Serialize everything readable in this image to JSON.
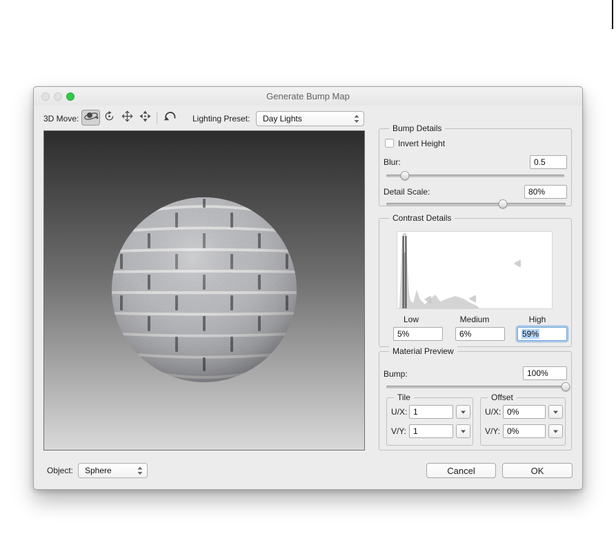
{
  "window": {
    "title": "Generate Bump Map"
  },
  "toolbar": {
    "move_label": "3D Move:",
    "tools": [
      "orbit",
      "roll",
      "pan",
      "slide"
    ],
    "selected_tool": "orbit",
    "lighting_preset_label": "Lighting Preset:",
    "lighting_preset_value": "Day Lights"
  },
  "bump_details": {
    "legend": "Bump Details",
    "invert_height_label": "Invert Height",
    "invert_height_checked": false,
    "blur_label": "Blur:",
    "blur_value": "0.5",
    "blur_slider_pct": 10.5,
    "detail_scale_label": "Detail Scale:",
    "detail_scale_value": "80%",
    "detail_scale_slider_pct": 65
  },
  "contrast_details": {
    "legend": "Contrast Details",
    "columns": [
      {
        "label": "Low",
        "value": "5%"
      },
      {
        "label": "Medium",
        "value": "6%"
      },
      {
        "label": "High",
        "value": "59%"
      }
    ],
    "high_focused": true,
    "histogram": {
      "markers": {
        "low": {
          "left_pct": 19.5,
          "top_pct": 88
        },
        "medium": {
          "left_pct": 48.7,
          "top_pct": 87
        },
        "high": {
          "left_pct": 77.5,
          "top_pct": 41
        }
      }
    }
  },
  "material_preview": {
    "legend": "Material Preview",
    "bump_label": "Bump:",
    "bump_value": "100%",
    "bump_slider_pct": 99.3,
    "tile": {
      "legend": "Tile",
      "rows": [
        {
          "label": "U/X:",
          "value": "1"
        },
        {
          "label": "V/Y:",
          "value": "1"
        }
      ]
    },
    "offset": {
      "legend": "Offset",
      "rows": [
        {
          "label": "U/X:",
          "value": "0%"
        },
        {
          "label": "V/Y:",
          "value": "0%"
        }
      ]
    }
  },
  "footer": {
    "object_label": "Object:",
    "object_value": "Sphere",
    "cancel_label": "Cancel",
    "ok_label": "OK"
  },
  "colors": {
    "dialog_bg": "#ececec",
    "focus_ring": "#74a7e0",
    "text_selection": "#b6d7fb",
    "traffic_green": "#32c94c",
    "preview_top": "#2c2c2c",
    "preview_bottom": "#d9d9d9"
  }
}
